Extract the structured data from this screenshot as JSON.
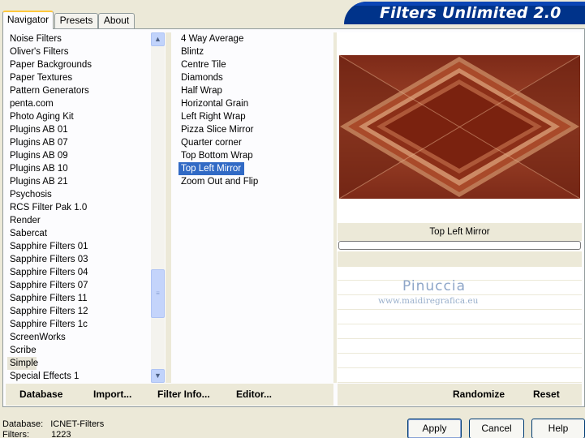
{
  "tabs": [
    {
      "label": "Navigator",
      "active": true
    },
    {
      "label": "Presets",
      "active": false
    },
    {
      "label": "About",
      "active": false
    }
  ],
  "banner": {
    "title": "Filters Unlimited 2.0"
  },
  "categories": [
    "Noise Filters",
    "Oliver's Filters",
    "Paper Backgrounds",
    "Paper Textures",
    "Pattern Generators",
    "penta.com",
    "Photo Aging Kit",
    "Plugins AB 01",
    "Plugins AB 07",
    "Plugins AB 09",
    "Plugins AB 10",
    "Plugins AB 21",
    "Psychosis",
    "RCS Filter Pak 1.0",
    "Render",
    "Sabercat",
    "Sapphire Filters 01",
    "Sapphire Filters 03",
    "Sapphire Filters 04",
    "Sapphire Filters 07",
    "Sapphire Filters 11",
    "Sapphire Filters 12",
    "Sapphire Filters 1c",
    "ScreenWorks",
    "Scribe",
    "Simple",
    "Special Effects 1"
  ],
  "selected_category": "Simple",
  "filters": [
    "4 Way Average",
    "Blintz",
    "Centre Tile",
    "Diamonds",
    "Half Wrap",
    "Horizontal Grain",
    "Left Right Wrap",
    "Pizza Slice Mirror",
    "Quarter corner",
    "Top Bottom Wrap",
    "Top Left Mirror",
    "Zoom Out and Flip"
  ],
  "selected_filter": "Top Left Mirror",
  "preview": {
    "label": "Top Left Mirror",
    "progress": 0
  },
  "watermark": {
    "name": "Pinuccia",
    "url": "www.maidiregrafica.eu"
  },
  "actions_left": {
    "database": "Database",
    "import": "Import...",
    "filter_info": "Filter Info...",
    "editor": "Editor..."
  },
  "actions_right": {
    "randomize": "Randomize",
    "reset": "Reset"
  },
  "status": {
    "database_label": "Database:",
    "database_value": "ICNET-Filters",
    "filters_label": "Filters:",
    "filters_value": "1223"
  },
  "buttons": {
    "apply": "Apply",
    "cancel": "Cancel",
    "help": "Help"
  },
  "colors": {
    "banner": "#00338a",
    "selection": "#316ac5",
    "accent_tab": "#ffc83c"
  }
}
